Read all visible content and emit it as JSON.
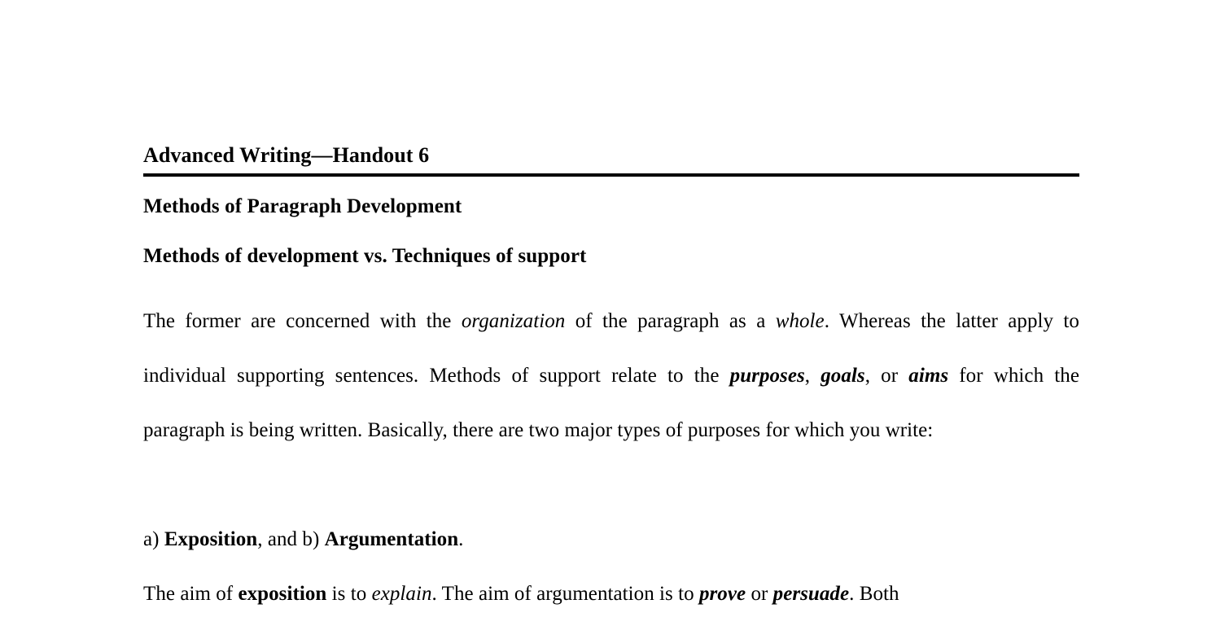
{
  "document": {
    "title": "Advanced Writing—Handout 6",
    "headings": {
      "h1": "Methods of Paragraph Development",
      "h2": "Methods of development vs. Techniques of support"
    },
    "paragraph_1": {
      "seg_1": "The former are concerned with the ",
      "seg_2_italic": "organization",
      "seg_3": " of the paragraph as a ",
      "seg_4_italic": "whole",
      "seg_5": ". Whereas the latter apply to individual supporting sentences. Methods of support relate to the ",
      "seg_6_bold_italic": "purposes",
      "seg_7": ", ",
      "seg_8_bold_italic": "goals",
      "seg_9": ", or ",
      "seg_10_bold_italic": "aims",
      "seg_11": " for which the paragraph is being written. Basically, there are two major types of purposes for which you write:"
    },
    "list_line": {
      "seg_1": "a) ",
      "seg_2_bold": "Exposition",
      "seg_3": ", and b) ",
      "seg_4_bold": "Argumentation",
      "seg_5": "."
    },
    "paragraph_2": {
      "seg_1": "The aim of ",
      "seg_2_bold": "exposition",
      "seg_3": " is to ",
      "seg_4_italic": "explain",
      "seg_5": ". The aim of argumentation is to ",
      "seg_6_bold_italic": "prove",
      "seg_7": " or ",
      "seg_8_bold_italic": "persuade",
      "seg_9": ". Both"
    }
  }
}
